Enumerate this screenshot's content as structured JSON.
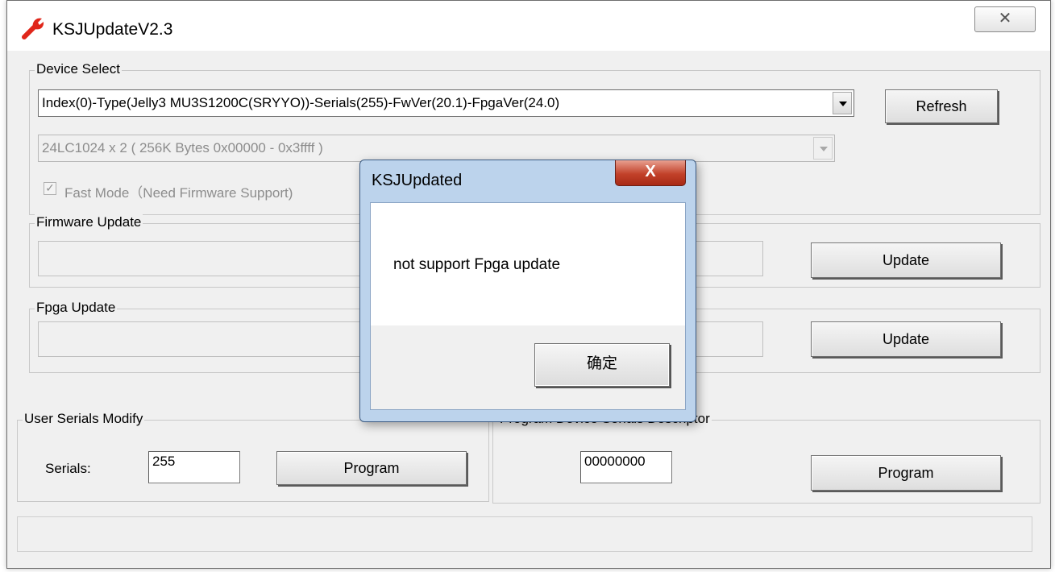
{
  "window": {
    "title": "KSJUpdateV2.3",
    "close_glyph": "✕"
  },
  "device_select": {
    "group_label": "Device Select",
    "device_combo_value": "Index(0)-Type(Jelly3 MU3S1200C(SRYYO))-Serials(255)-FwVer(20.1)-FpgaVer(24.0)",
    "eeprom_combo_value": "24LC1024 x 2 ( 256K Bytes 0x00000 - 0x3ffff )",
    "refresh_label": "Refresh",
    "fast_mode_label": "Fast Mode（Need Firmware Support)",
    "fast_mode_checked": true
  },
  "firmware_update": {
    "group_label": "Firmware Update",
    "update_label": "Update"
  },
  "fpga_update": {
    "group_label": "Fpga Update",
    "update_label": "Update"
  },
  "user_serials": {
    "group_label": "User Serials Modify",
    "serials_label": "Serials:",
    "serials_value": "255",
    "program_label": "Program"
  },
  "program_descriptor": {
    "group_label": "Program Device Serials Descriptor",
    "descriptor_value": "00000000",
    "program_label": "Program"
  },
  "dialog": {
    "title": "KSJUpdated",
    "message": "not support Fpga update",
    "ok_label": "确定",
    "close_glyph": "X"
  },
  "colors": {
    "window_bg": "#f0f0f0",
    "dialog_frame": "#bcd3ec",
    "dialog_close": "#c2412a",
    "app_icon": "#e0261a"
  }
}
